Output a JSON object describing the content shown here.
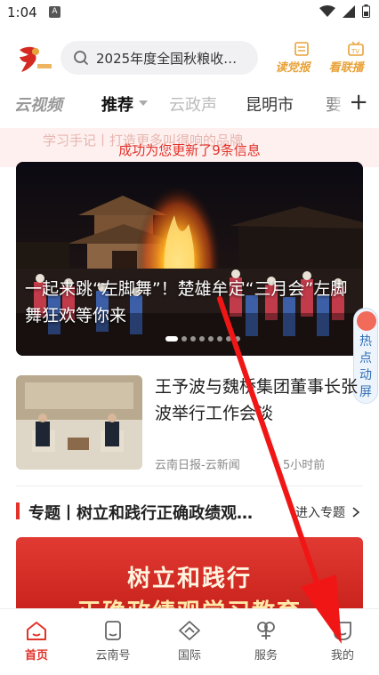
{
  "status_bar": {
    "time": "1:04",
    "notif_letter": "A"
  },
  "header": {
    "search_placeholder": "2025年度全国秋粮收…",
    "read_paper_label": "读党报",
    "watch_news_label": "看联播",
    "watch_news_badge": "TV"
  },
  "tabs": [
    {
      "label": "云视频"
    },
    {
      "label": "推荐"
    },
    {
      "label": "云政声"
    },
    {
      "label": "昆明市"
    },
    {
      "label": "要"
    }
  ],
  "tabs_add": "+",
  "notice": {
    "background_text": "学习手记丨打造更多叫得响的品牌",
    "message": "成功为您更新了9条信息"
  },
  "feature": {
    "title": "一起来跳“左脚舞”！楚雄牟定“三月会”左脚舞狂欢等你来",
    "dot_count": 8,
    "active_dot": 0
  },
  "hot_float": {
    "label": "热点动屏"
  },
  "news": {
    "title": "王予波与魏桥集团董事长张波举行工作会谈",
    "source": "云南日报-云新闻",
    "time": "5小时前"
  },
  "topic": {
    "title": "专题丨树立和践行正确政绩观…",
    "enter_label": "进入专题"
  },
  "banner": {
    "line1": "树立和践行",
    "line2": "正确政绩观学习教育"
  },
  "bottom_nav": [
    {
      "label": "首页",
      "icon": "home-icon",
      "active": true
    },
    {
      "label": "云南号",
      "icon": "yunnan-account-icon",
      "active": false
    },
    {
      "label": "国际",
      "icon": "international-icon",
      "active": false
    },
    {
      "label": "服务",
      "icon": "service-icon",
      "active": false
    },
    {
      "label": "我的",
      "icon": "profile-icon",
      "active": false
    }
  ],
  "colors": {
    "accent": "#e2322a",
    "gold": "#e8a23a",
    "hot_blue": "#2f6fb8"
  }
}
